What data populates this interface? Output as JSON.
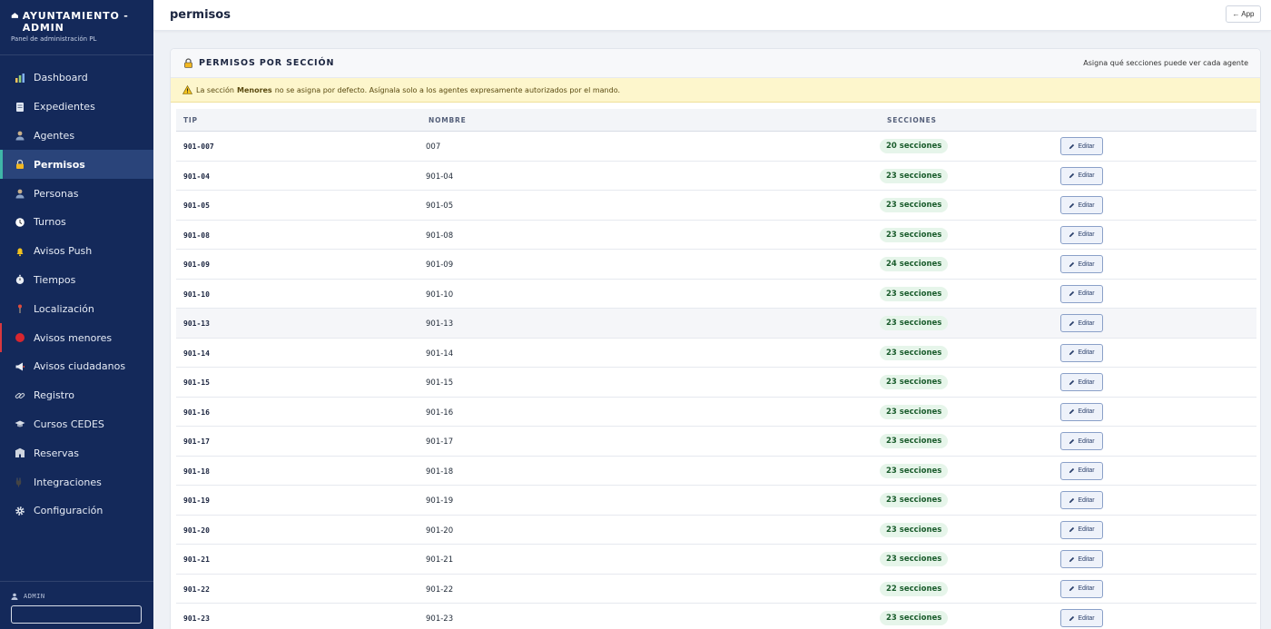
{
  "sidebar": {
    "brand_title": "AYUNTAMIENTO - ADMIN",
    "brand_subtitle": "Panel de administración PL",
    "items": [
      {
        "label": "Dashboard",
        "icon": "bar-chart-icon"
      },
      {
        "label": "Expedientes",
        "icon": "document-icon"
      },
      {
        "label": "Agentes",
        "icon": "user-icon"
      },
      {
        "label": "Permisos",
        "icon": "lock-icon",
        "active": true
      },
      {
        "label": "Personas",
        "icon": "user-icon"
      },
      {
        "label": "Turnos",
        "icon": "clock-icon"
      },
      {
        "label": "Avisos Push",
        "icon": "bell-icon"
      },
      {
        "label": "Tiempos",
        "icon": "stopwatch-icon"
      },
      {
        "label": "Localización",
        "icon": "pin-icon"
      },
      {
        "label": "Avisos menores",
        "icon": "red-circle-icon"
      },
      {
        "label": "Avisos ciudadanos",
        "icon": "megaphone-icon"
      },
      {
        "label": "Registro",
        "icon": "link-icon"
      },
      {
        "label": "Cursos CEDES",
        "icon": "graduation-cap-icon"
      },
      {
        "label": "Reservas",
        "icon": "building-icon"
      },
      {
        "label": "Integraciones",
        "icon": "plug-icon"
      },
      {
        "label": "Configuración",
        "icon": "gear-icon"
      }
    ],
    "user_label": "ADMIN"
  },
  "header": {
    "title": "permisos",
    "app_button": "← App"
  },
  "card": {
    "title": "PERMISOS POR SECCIÓN",
    "subtitle": "Asigna qué secciones puede ver cada agente",
    "warning_prefix": "La sección",
    "warning_bold": "Menores",
    "warning_suffix": "no se asigna por defecto. Asígnala solo a los agentes expresamente autorizados por el mando."
  },
  "table": {
    "headers": {
      "tip": "TIP",
      "nombre": "NOMBRE",
      "secciones": "SECCIONES"
    },
    "edit_label": "Editar",
    "rows": [
      {
        "tip": "901-007",
        "nombre": "007",
        "secciones": "20 secciones"
      },
      {
        "tip": "901-04",
        "nombre": "901-04",
        "secciones": "23 secciones"
      },
      {
        "tip": "901-05",
        "nombre": "901-05",
        "secciones": "23 secciones"
      },
      {
        "tip": "901-08",
        "nombre": "901-08",
        "secciones": "23 secciones"
      },
      {
        "tip": "901-09",
        "nombre": "901-09",
        "secciones": "24 secciones"
      },
      {
        "tip": "901-10",
        "nombre": "901-10",
        "secciones": "23 secciones"
      },
      {
        "tip": "901-13",
        "nombre": "901-13",
        "secciones": "23 secciones",
        "highlighted": true
      },
      {
        "tip": "901-14",
        "nombre": "901-14",
        "secciones": "23 secciones"
      },
      {
        "tip": "901-15",
        "nombre": "901-15",
        "secciones": "23 secciones"
      },
      {
        "tip": "901-16",
        "nombre": "901-16",
        "secciones": "23 secciones"
      },
      {
        "tip": "901-17",
        "nombre": "901-17",
        "secciones": "23 secciones"
      },
      {
        "tip": "901-18",
        "nombre": "901-18",
        "secciones": "23 secciones"
      },
      {
        "tip": "901-19",
        "nombre": "901-19",
        "secciones": "23 secciones"
      },
      {
        "tip": "901-20",
        "nombre": "901-20",
        "secciones": "23 secciones"
      },
      {
        "tip": "901-21",
        "nombre": "901-21",
        "secciones": "23 secciones"
      },
      {
        "tip": "901-22",
        "nombre": "901-22",
        "secciones": "22 secciones"
      },
      {
        "tip": "901-23",
        "nombre": "901-23",
        "secciones": "23 secciones"
      }
    ]
  },
  "colors": {
    "sidebar_bg": "#14295a",
    "active_accent": "#3fb6a8",
    "badge_bg": "#e6f5ea",
    "warning_bg": "#fdf6cc"
  }
}
